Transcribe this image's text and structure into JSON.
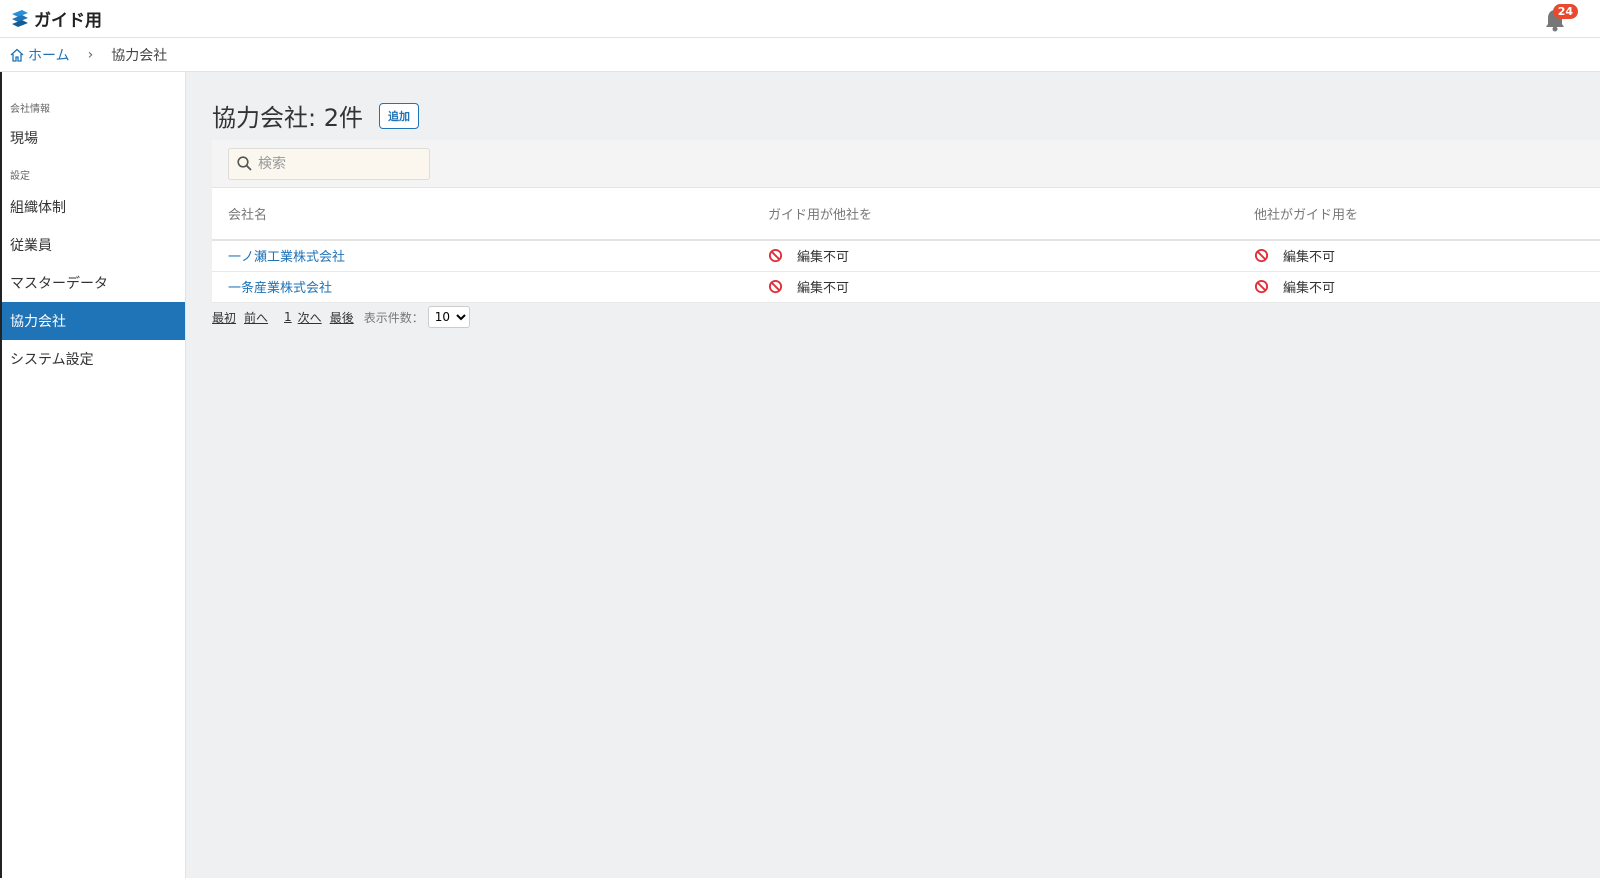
{
  "header": {
    "app_title": "ガイド用",
    "notification_count": "24"
  },
  "breadcrumb": {
    "home": "ホーム",
    "separator": "›",
    "current": "協力会社"
  },
  "sidebar": {
    "sections": [
      {
        "label": "会社情報",
        "items": [
          {
            "label": "現場"
          }
        ]
      },
      {
        "label": "設定",
        "items": [
          {
            "label": "組織体制"
          },
          {
            "label": "従業員"
          },
          {
            "label": "マスターデータ"
          },
          {
            "label": "協力会社",
            "active": true
          },
          {
            "label": "システム設定"
          }
        ]
      }
    ]
  },
  "main": {
    "title": "協力会社: 2件",
    "add_label": "追加",
    "search_placeholder": "検索",
    "columns": [
      "会社名",
      "ガイド用が他社を",
      "他社がガイド用を"
    ],
    "rows": [
      {
        "name": "一ノ瀬工業株式会社",
        "perm1": "編集不可",
        "perm2": "編集不可"
      },
      {
        "name": "一条産業株式会社",
        "perm1": "編集不可",
        "perm2": "編集不可"
      }
    ],
    "pager": {
      "first": "最初",
      "prev": "前へ",
      "page": "1",
      "next": "次へ",
      "last": "最後",
      "per_page_label": "表示件数：",
      "per_page_value": "10"
    }
  },
  "colors": {
    "accent": "#1f73b7",
    "badge": "#e8492f",
    "deny": "#e0303a"
  }
}
